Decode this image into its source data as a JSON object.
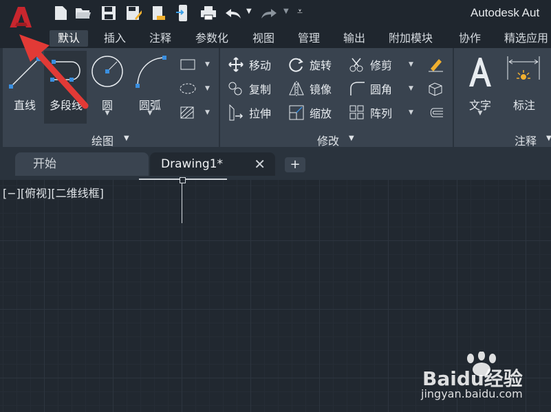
{
  "app": {
    "title": "Autodesk Aut"
  },
  "quick_access": [
    "new-icon",
    "open-icon",
    "save-icon",
    "save-as-icon",
    "share-icon",
    "publish-icon",
    "print-icon",
    "undo-icon",
    "redo-icon",
    "customize-icon"
  ],
  "ribbon_tabs": [
    "默认",
    "插入",
    "注释",
    "参数化",
    "视图",
    "管理",
    "输出",
    "附加模块",
    "协作",
    "精选应用"
  ],
  "draw_panel": {
    "title": "绘图",
    "buttons": [
      {
        "label": "直线"
      },
      {
        "label": "多段线"
      },
      {
        "label": "圆"
      },
      {
        "label": "圆弧"
      }
    ]
  },
  "modify_panel": {
    "title": "修改",
    "items": [
      {
        "label": "移动"
      },
      {
        "label": "旋转"
      },
      {
        "label": "修剪"
      },
      {
        "label": "复制"
      },
      {
        "label": "镜像"
      },
      {
        "label": "圆角"
      },
      {
        "label": "拉伸"
      },
      {
        "label": "缩放"
      },
      {
        "label": "阵列"
      }
    ]
  },
  "annotation_panel": {
    "title": "注释",
    "buttons": [
      {
        "label": "文字"
      },
      {
        "label": "标注"
      }
    ]
  },
  "doc_tabs": [
    {
      "label": "开始"
    },
    {
      "label": "Drawing1*"
    }
  ],
  "viewport": {
    "label": "[−][俯视][二维线框]"
  },
  "watermark": {
    "brand": "Baidu经验",
    "url": "jingyan.baidu.com"
  },
  "colors": {
    "accent_red": "#c8262e",
    "arrow_red": "#e23a36",
    "ribbon": "#39434f",
    "canvas": "#212830"
  }
}
